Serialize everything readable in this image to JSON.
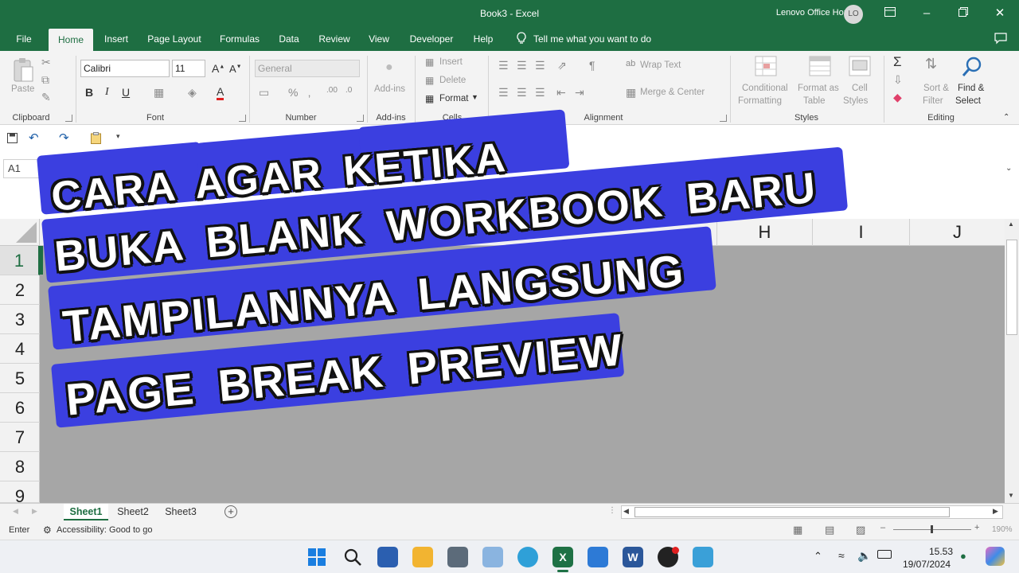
{
  "window": {
    "title": "Book3  -  Excel",
    "user": "Lenovo Office Home",
    "avatar": "LO"
  },
  "menu": {
    "tabs": [
      "File",
      "Home",
      "Insert",
      "Page Layout",
      "Formulas",
      "Data",
      "Review",
      "View",
      "Developer",
      "Help"
    ],
    "active": "Home",
    "tellme": "Tell me what you want to do"
  },
  "ribbon": {
    "clipboard": {
      "paste": "Paste",
      "label": "Clipboard"
    },
    "font": {
      "name": "Calibri",
      "size": "11",
      "label": "Font",
      "bold": "B",
      "italic": "I",
      "underline": "U"
    },
    "number": {
      "format": "General",
      "label": "Number"
    },
    "addins": {
      "button": "Add-ins",
      "label": "Add-ins"
    },
    "cells": {
      "insert": "Insert",
      "delete": "Delete",
      "format": "Format",
      "label": "Cells"
    },
    "alignment": {
      "wrap": "Wrap Text",
      "merge": "Merge & Center",
      "label": "Alignment"
    },
    "styles": {
      "conditional_1": "Conditional",
      "conditional_2": "Formatting",
      "format_table_1": "Format as",
      "format_table_2": "Table",
      "cell_styles_1": "Cell",
      "cell_styles_2": "Styles",
      "label": "Styles"
    },
    "editing": {
      "sort_1": "Sort &",
      "sort_2": "Filter",
      "find_1": "Find &",
      "find_2": "Select",
      "label": "Editing"
    }
  },
  "formula_bar": {
    "name_box": "A1"
  },
  "grid": {
    "columns": [
      "H",
      "I",
      "J"
    ],
    "rows": [
      "1",
      "2",
      "3",
      "4",
      "5",
      "6",
      "7",
      "8",
      "9"
    ]
  },
  "sheets": [
    "Sheet1",
    "Sheet2",
    "Sheet3"
  ],
  "active_sheet": "Sheet1",
  "status": {
    "mode": "Enter",
    "accessibility": "Accessibility: Good to go",
    "zoom": "190%"
  },
  "taskbar": {
    "time": "15.53",
    "date": "19/07/2024"
  },
  "overlay": {
    "line1": "CARA AGAR KETIKA",
    "line2": "BUKA BLANK WORKBOOK BARU",
    "line3": "TAMPILANNYA LANGSUNG",
    "line4": "PAGE BREAK PREVIEW",
    "band_color": "#3b3fe0"
  }
}
